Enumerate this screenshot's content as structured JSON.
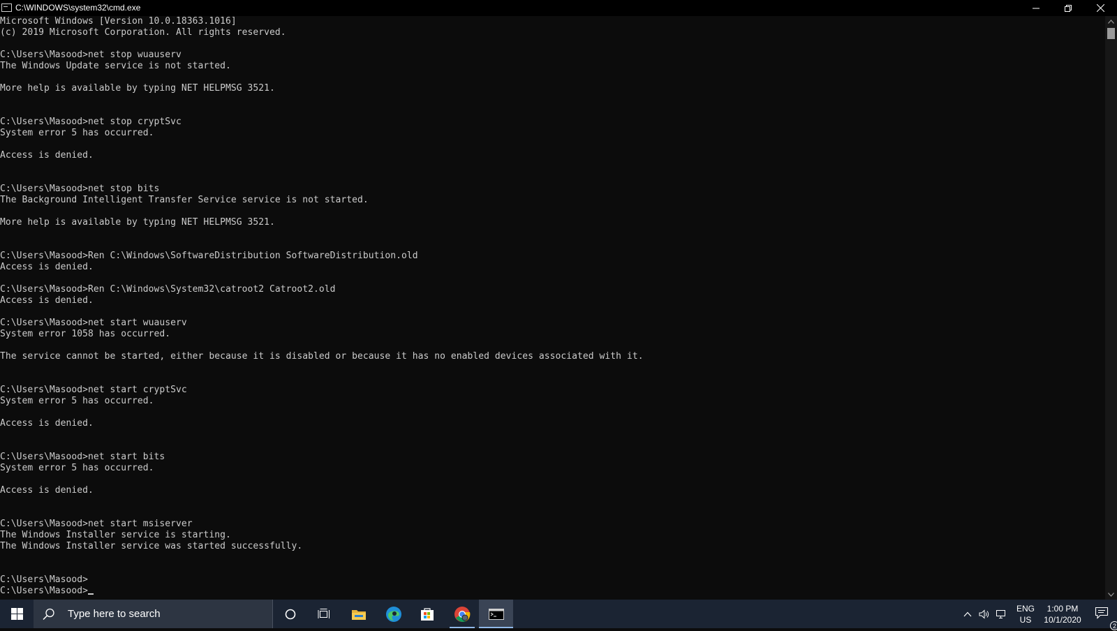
{
  "window": {
    "title": "C:\\WINDOWS\\system32\\cmd.exe",
    "icon": "cmd-icon"
  },
  "console": {
    "lines": [
      "Microsoft Windows [Version 10.0.18363.1016]",
      "(c) 2019 Microsoft Corporation. All rights reserved.",
      "",
      "C:\\Users\\Masood>net stop wuauserv",
      "The Windows Update service is not started.",
      "",
      "More help is available by typing NET HELPMSG 3521.",
      "",
      "",
      "C:\\Users\\Masood>net stop cryptSvc",
      "System error 5 has occurred.",
      "",
      "Access is denied.",
      "",
      "",
      "C:\\Users\\Masood>net stop bits",
      "The Background Intelligent Transfer Service service is not started.",
      "",
      "More help is available by typing NET HELPMSG 3521.",
      "",
      "",
      "C:\\Users\\Masood>Ren C:\\Windows\\SoftwareDistribution SoftwareDistribution.old",
      "Access is denied.",
      "",
      "C:\\Users\\Masood>Ren C:\\Windows\\System32\\catroot2 Catroot2.old",
      "Access is denied.",
      "",
      "C:\\Users\\Masood>net start wuauserv",
      "System error 1058 has occurred.",
      "",
      "The service cannot be started, either because it is disabled or because it has no enabled devices associated with it.",
      "",
      "",
      "C:\\Users\\Masood>net start cryptSvc",
      "System error 5 has occurred.",
      "",
      "Access is denied.",
      "",
      "",
      "C:\\Users\\Masood>net start bits",
      "System error 5 has occurred.",
      "",
      "Access is denied.",
      "",
      "",
      "C:\\Users\\Masood>net start msiserver",
      "The Windows Installer service is starting.",
      "The Windows Installer service was started successfully.",
      "",
      "",
      "C:\\Users\\Masood>"
    ],
    "prompt": "C:\\Users\\Masood>"
  },
  "taskbar": {
    "search_placeholder": "Type here to search",
    "language": "ENG",
    "region": "US",
    "time": "1:00 PM",
    "date": "10/1/2020",
    "notification_count": "2",
    "pinned_apps": [
      "file-explorer-icon",
      "edge-icon",
      "store-icon",
      "chrome-icon",
      "cmd-icon"
    ]
  },
  "colors": {
    "console_bg": "#0c0c0c",
    "console_text": "#cccccc",
    "taskbar_bg": "#1b2433",
    "accent": "#8fb8e8"
  }
}
